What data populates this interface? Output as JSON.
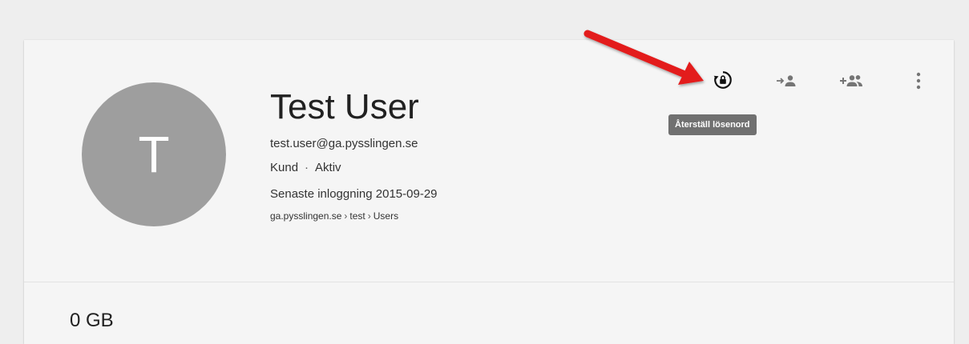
{
  "user": {
    "avatar_letter": "T",
    "name": "Test User",
    "email": "test.user@ga.pysslingen.se",
    "role": "Kund",
    "status": "Aktiv",
    "status_separator": "·",
    "last_login": "Senaste inloggning 2015-09-29",
    "path": [
      "ga.pysslingen.se",
      "test",
      "Users"
    ],
    "path_separator": "›"
  },
  "storage": {
    "usage": "0 GB"
  },
  "actions": {
    "reset_password_icon": "lock-reset-icon",
    "add_to_group_icon": "person-arrow-icon",
    "add_users_icon": "group-add-icon",
    "more_icon": "more-vert-icon",
    "tooltip": "Återställ lösenord"
  },
  "annotation": {
    "arrow_color": "#e31a1a"
  },
  "colors": {
    "card_bg": "#f5f5f5",
    "page_bg": "#eeeeee",
    "avatar_bg": "#9e9e9e",
    "icon_color": "#757575",
    "tooltip_bg": "#707070"
  }
}
